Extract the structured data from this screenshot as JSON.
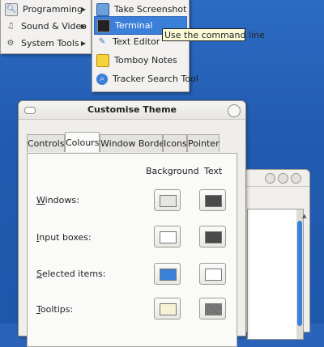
{
  "menu_left": {
    "items": [
      {
        "label": "Programming",
        "icon": "programming-icon"
      },
      {
        "label": "Sound & Video",
        "icon": "sound-video-icon"
      },
      {
        "label": "System Tools",
        "icon": "system-tools-icon"
      }
    ]
  },
  "menu_right": {
    "items": [
      {
        "label": "Take Screenshot",
        "icon": "screenshot-icon"
      },
      {
        "label": "Terminal",
        "icon": "terminal-icon",
        "selected": true
      },
      {
        "label": "Text Editor",
        "icon": "text-editor-icon"
      },
      {
        "label": "Tomboy Notes",
        "icon": "tomboy-notes-icon"
      },
      {
        "label": "Tracker Search Tool",
        "icon": "tracker-search-icon"
      }
    ]
  },
  "tooltip": "Use the command line",
  "dialog": {
    "title": "Customise Theme",
    "tabs": [
      "Controls",
      "Colours",
      "Window Border",
      "Icons",
      "Pointer"
    ],
    "active_tab": "Colours",
    "columns": {
      "background": "Background",
      "text": "Text"
    },
    "rows": [
      {
        "label": "Windows:",
        "bg": "#e5e5e3",
        "fg": "#4a4a4a"
      },
      {
        "label": "Input boxes:",
        "bg": "#ffffff",
        "fg": "#4a4a4a"
      },
      {
        "label": "Selected items:",
        "bg": "#3a7fd8",
        "fg": "#ffffff"
      },
      {
        "label": "Tooltips:",
        "bg": "#f5f2d6",
        "fg": "#555555"
      }
    ]
  },
  "colors": {
    "desktop": "#2a63b8",
    "selection": "#3a7fd8"
  }
}
